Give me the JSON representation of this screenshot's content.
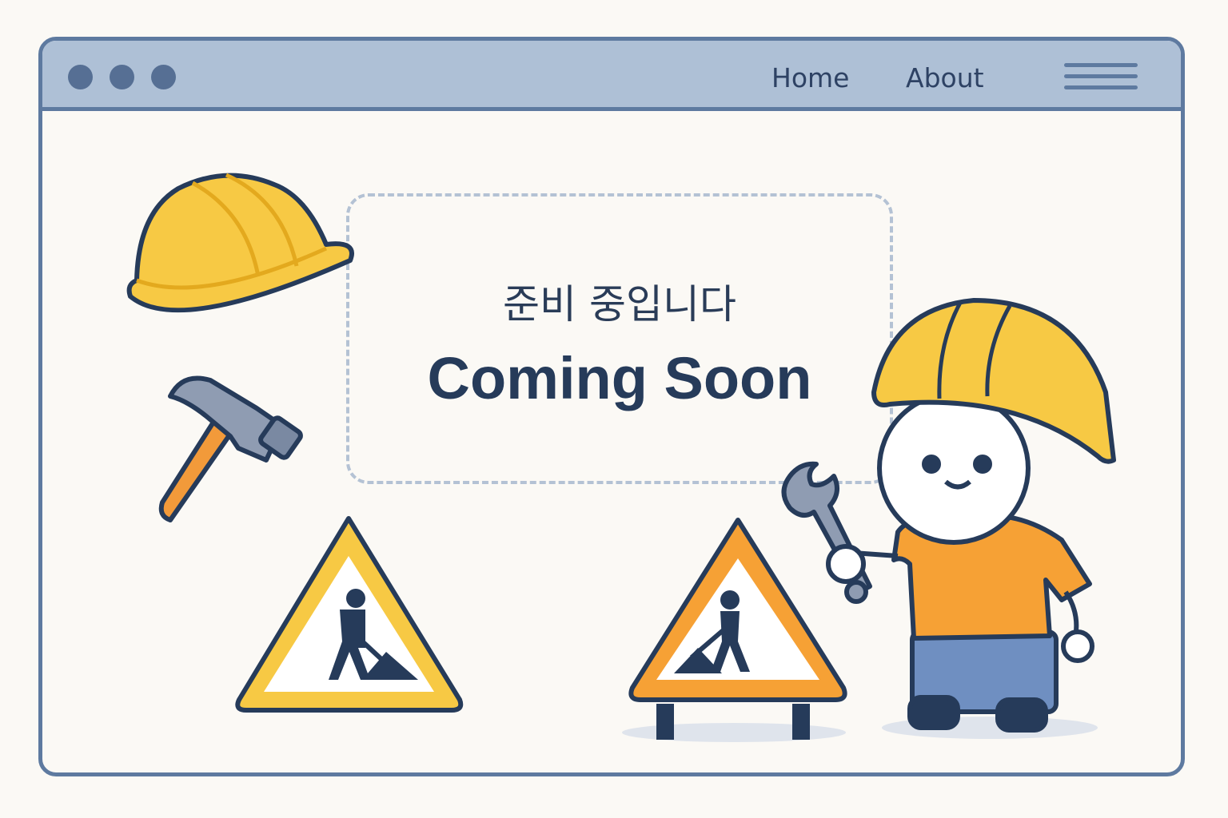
{
  "nav": {
    "home_label": "Home",
    "about_label": "About"
  },
  "hero": {
    "title_ko": "준비 중입니다",
    "title_en": "Coming Soon"
  },
  "colors": {
    "frame": "#5e7aa0",
    "titlebar": "#aec0d6",
    "helmet": "#f7c944",
    "orange": "#f6a135",
    "ink": "#263b5a"
  },
  "icons": [
    "hard-hat-icon",
    "hammer-icon",
    "warning-sign-icon",
    "barrier-sign-icon",
    "worker-character",
    "wrench-icon",
    "menu-icon"
  ]
}
